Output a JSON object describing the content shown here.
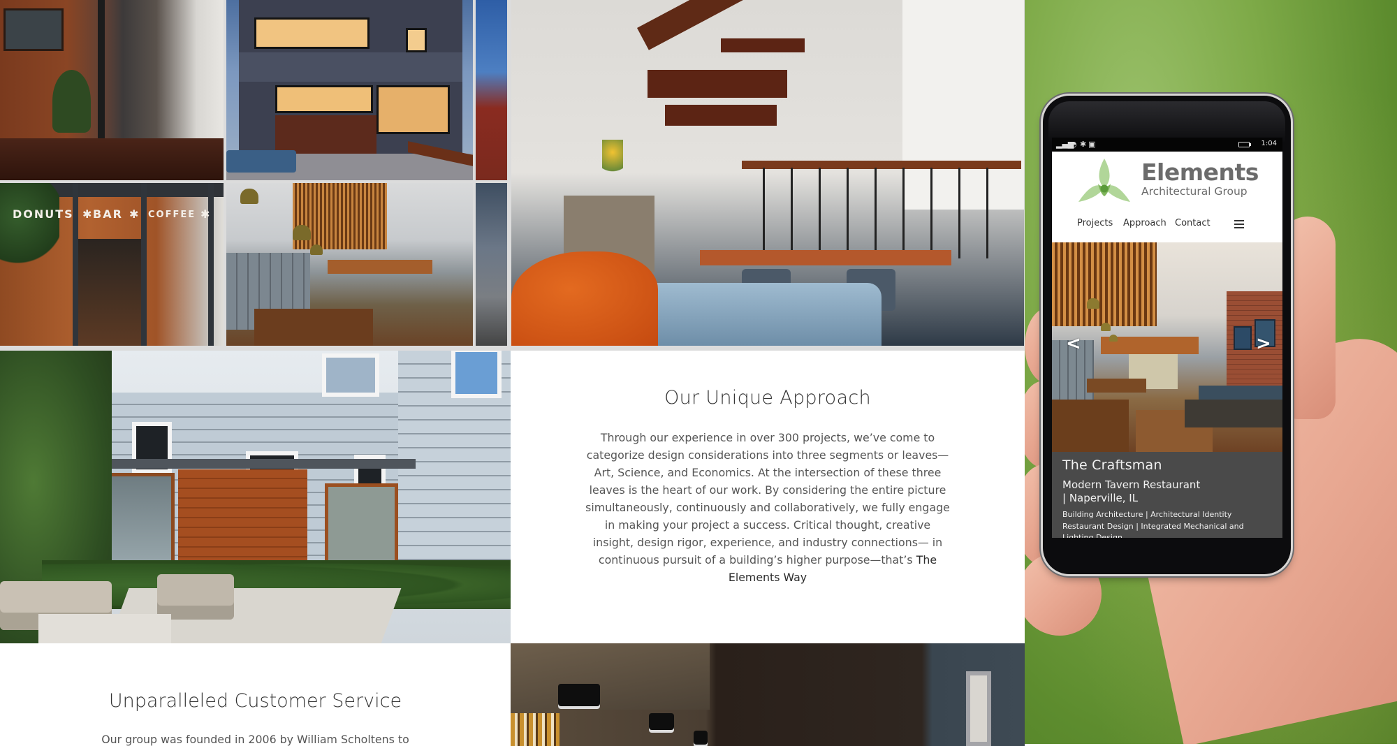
{
  "website": {
    "approach": {
      "heading": "Our Unique Approach",
      "body": "Through our experience in over 300 projects, we’ve come to categorize design considerations into three segments or leaves—Art, Science, and Economics. At the intersection of these three leaves is the heart of our work. By considering the entire picture simultaneously, continuously and collaboratively, we fully engage in making your project a success. Critical thought, creative insight, design rigor, experience, and industry connections— in continuous pursuit of a building’s higher purpose—that’s ",
      "emphasis": "The Elements Way"
    },
    "service": {
      "heading": "Unparalleled Customer Service",
      "body": "Our group was founded in 2006 by William Scholtens to"
    },
    "storefront_sign": {
      "left": "DONUTS",
      "middle": "BAR",
      "right": "COFFEE",
      "star": "✱"
    }
  },
  "phone": {
    "status_bar": {
      "signal_icon": "signal-icon",
      "wifi_icon": "wifi-icon",
      "bluetooth_icon": "bluetooth-icon",
      "message_icon": "message-icon",
      "battery_icon": "battery-icon",
      "time": "1:04"
    },
    "site": {
      "logo_word": "Elements",
      "logo_sub": "Architectural Group",
      "logo_colors": {
        "leaf": "#a9d18e",
        "overlap": "#7fb55c",
        "center": "#5a9a3a"
      },
      "nav": [
        {
          "label": "Projects"
        },
        {
          "label": "Approach"
        },
        {
          "label": "Contact"
        }
      ],
      "menu_icon": "hamburger-icon",
      "carousel": {
        "prev": "<",
        "next": ">"
      },
      "caption": {
        "title": "The Craftsman",
        "subtitle": "Modern Tavern Restaurant | Naperville, IL",
        "services_line1": "Building Architecture | Architectural Identity",
        "services_line2": "Restaurant Design | Integrated Mechanical and",
        "services_line3": "Lighting Design"
      }
    }
  },
  "colors": {
    "caption_bg": "#4a4a4a",
    "background_green": "#7eaa48",
    "text_dark": "#333333",
    "text_body": "#555555"
  }
}
